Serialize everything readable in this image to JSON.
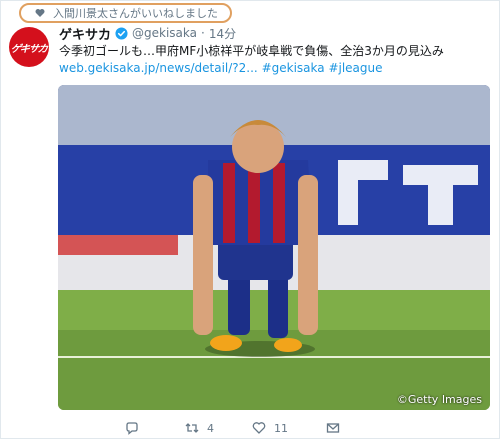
{
  "context": {
    "icon": "heart-icon",
    "text": "入間川景太さんがいいねしました"
  },
  "author": {
    "avatar_text": "ゲキサカ",
    "display_name": "ゲキサカ",
    "verified": true,
    "handle": "@gekisaka",
    "separator": "·",
    "time": "14分"
  },
  "tweet": {
    "text": "今季初ゴールも…甲府MF小椋祥平が岐阜戦で負傷、全治3か月の見込み",
    "url": "web.gekisaka.jp/news/detail/?2...",
    "hashtag1": "#gekisaka",
    "hashtag2": "#jleague"
  },
  "media": {
    "alt": "football player kneeling on pitch",
    "credit": "©Getty Images"
  },
  "actions": {
    "reply_count": "",
    "retweet_count": "4",
    "like_count": "11",
    "message_count": ""
  },
  "colors": {
    "accent": "#1b95e0",
    "brand": "#d4101c",
    "highlight": "#e0a060"
  }
}
